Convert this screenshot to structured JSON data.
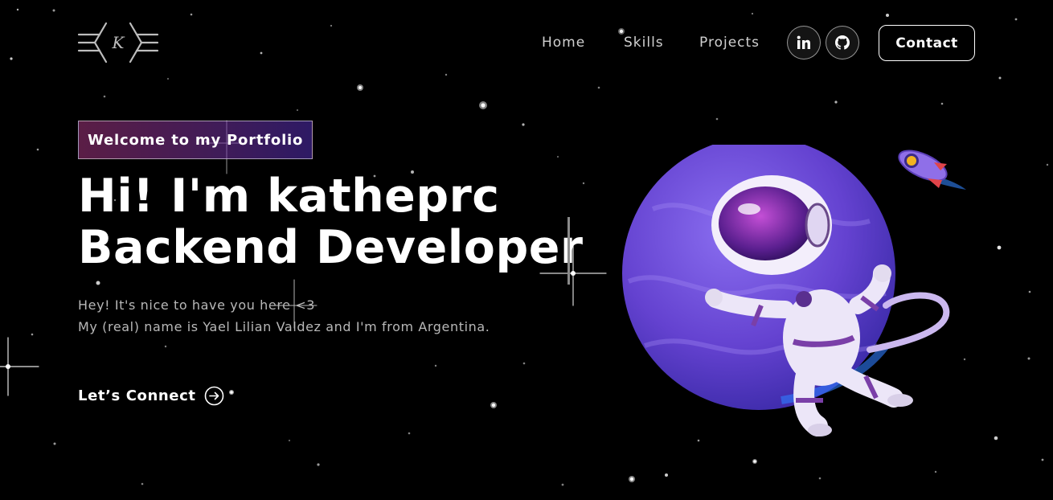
{
  "logo": {
    "letter": "K"
  },
  "nav": {
    "links": [
      "Home",
      "Skills",
      "Projects"
    ],
    "social": [
      {
        "icon": "linkedin-icon",
        "label": "in"
      },
      {
        "icon": "github-icon"
      }
    ],
    "contact_label": "Contact"
  },
  "hero": {
    "tagline": "Welcome to my Portfolio",
    "title_line1": "Hi! I'm katheprc",
    "title_line2": "Backend Developer",
    "desc_line1": "Hey! It's nice to have you here <3",
    "desc_line2": "My (real) name is Yael Lilian Valdez and I'm from Argentina.",
    "connect_label": "Let’s Connect"
  },
  "colors": {
    "background": "#000000",
    "tagline_gradient_start": "#aa367c",
    "tagline_gradient_end": "#4a2fbd",
    "planet": "#6b46d6",
    "text_muted": "#b8b8b8"
  }
}
